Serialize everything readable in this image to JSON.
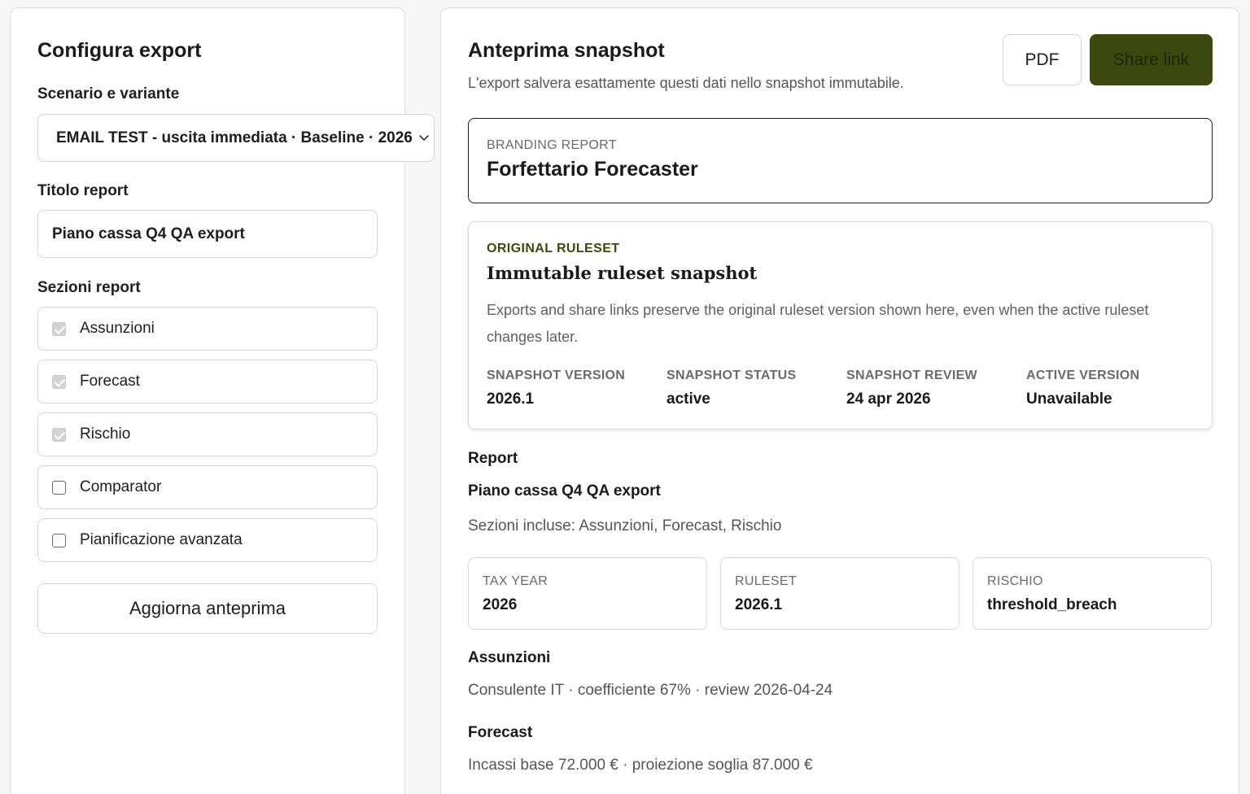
{
  "config": {
    "title": "Configura export",
    "scenario_label": "Scenario e variante",
    "scenario_value": "EMAIL TEST - uscita immediata · Baseline · 2026",
    "report_title_label": "Titolo report",
    "report_title_value": "Piano cassa Q4 QA export",
    "sections_label": "Sezioni report",
    "sections": [
      {
        "label": "Assunzioni",
        "checked": true
      },
      {
        "label": "Forecast",
        "checked": true
      },
      {
        "label": "Rischio",
        "checked": true
      },
      {
        "label": "Comparator",
        "checked": false
      },
      {
        "label": "Pianificazione avanzata",
        "checked": false
      }
    ],
    "refresh_button": "Aggiorna anteprima"
  },
  "preview": {
    "title": "Anteprima snapshot",
    "subtitle": "L'export salvera esattamente questi dati nello snapshot immutabile.",
    "pdf_button": "PDF",
    "share_button": "Share link",
    "branding_label": "BRANDING REPORT",
    "branding_name": "Forfettario Forecaster",
    "ruleset": {
      "kicker": "ORIGINAL RULESET",
      "title": "Immutable ruleset snapshot",
      "description": "Exports and share links preserve the original ruleset version shown here, even when the active ruleset changes later.",
      "meta": [
        {
          "label": "SNAPSHOT VERSION",
          "value": "2026.1"
        },
        {
          "label": "SNAPSHOT STATUS",
          "value": "active"
        },
        {
          "label": "SNAPSHOT REVIEW",
          "value": "24 apr 2026"
        },
        {
          "label": "ACTIVE VERSION",
          "value": "Unavailable"
        }
      ]
    },
    "report_heading": "Report",
    "report_name": "Piano cassa Q4 QA export",
    "included_sections": "Sezioni incluse: Assunzioni, Forecast, Rischio",
    "stats": [
      {
        "label": "TAX YEAR",
        "value": "2026"
      },
      {
        "label": "RULESET",
        "value": "2026.1"
      },
      {
        "label": "RISCHIO",
        "value": "threshold_breach"
      }
    ],
    "assumptions_heading": "Assunzioni",
    "assumptions_text": "Consulente IT · coefficiente 67% · review 2026-04-24",
    "forecast_heading": "Forecast",
    "forecast_text": "Incassi base 72.000 € · proiezione soglia 87.000 €"
  },
  "colors": {
    "accent": "#3b4a0c",
    "accent_text": "#1d2205",
    "border": "#d5d5d5"
  }
}
